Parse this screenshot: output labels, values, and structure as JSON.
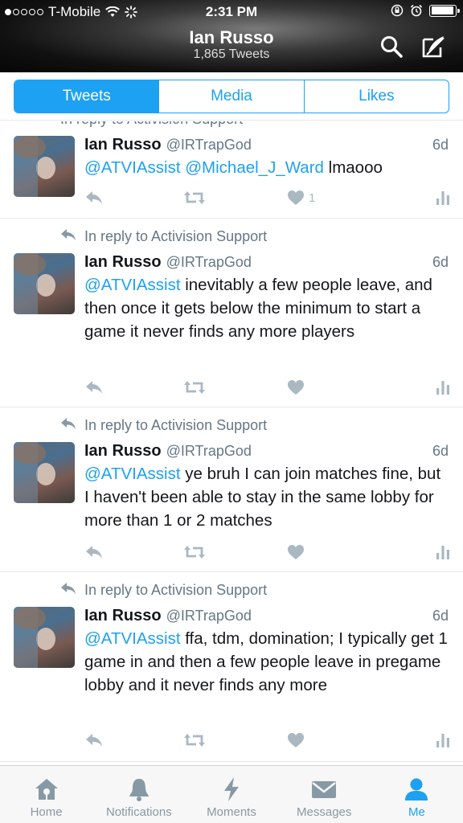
{
  "status_bar": {
    "carrier": "T-Mobile",
    "time": "2:31 PM",
    "signal_dots_filled": 1,
    "signal_dots_total": 5,
    "battery_level": 0.95
  },
  "profile": {
    "name": "Ian Russo",
    "tweet_count": "1,865 Tweets"
  },
  "header_icons": [
    "search-icon",
    "compose-icon"
  ],
  "segmented": {
    "tabs": [
      "Tweets",
      "Media",
      "Likes"
    ],
    "active": "Tweets"
  },
  "peek_text": "In reply to Activision Support",
  "tweets": [
    {
      "reply_context": "",
      "name": "Ian Russo",
      "handle": "@IRTrapGod",
      "time": "6d",
      "mentions": "@ATVIAssist @Michael_J_Ward",
      "text": " lmaooo",
      "like_count": "1"
    },
    {
      "reply_context": "In reply to Activision Support",
      "name": "Ian Russo",
      "handle": "@IRTrapGod",
      "time": "6d",
      "mentions": "@ATVIAssist",
      "text": " inevitably a few people leave, and then once it gets below the minimum to start a game it never finds any more players",
      "like_count": ""
    },
    {
      "reply_context": "In reply to Activision Support",
      "name": "Ian Russo",
      "handle": "@IRTrapGod",
      "time": "6d",
      "mentions": "@ATVIAssist",
      "text": " ye bruh I can join matches fine, but I haven't been able to stay in the same lobby for more than 1 or 2 matches",
      "like_count": ""
    },
    {
      "reply_context": "In reply to Activision Support",
      "name": "Ian Russo",
      "handle": "@IRTrapGod",
      "time": "6d",
      "mentions": "@ATVIAssist",
      "text": " ffa, tdm, domination; I typically get 1 game in and then a few people leave in pregame lobby and it never finds any more",
      "like_count": ""
    }
  ],
  "tab_bar": {
    "items": [
      {
        "label": "Home",
        "icon": "home-icon"
      },
      {
        "label": "Notifications",
        "icon": "bell-icon"
      },
      {
        "label": "Moments",
        "icon": "lightning-icon"
      },
      {
        "label": "Messages",
        "icon": "envelope-icon"
      },
      {
        "label": "Me",
        "icon": "person-icon"
      }
    ],
    "active": "Me"
  },
  "colors": {
    "accent": "#1da1f2",
    "muted": "#657786",
    "icon_gray": "#aab8c2",
    "text": "#14171a"
  }
}
